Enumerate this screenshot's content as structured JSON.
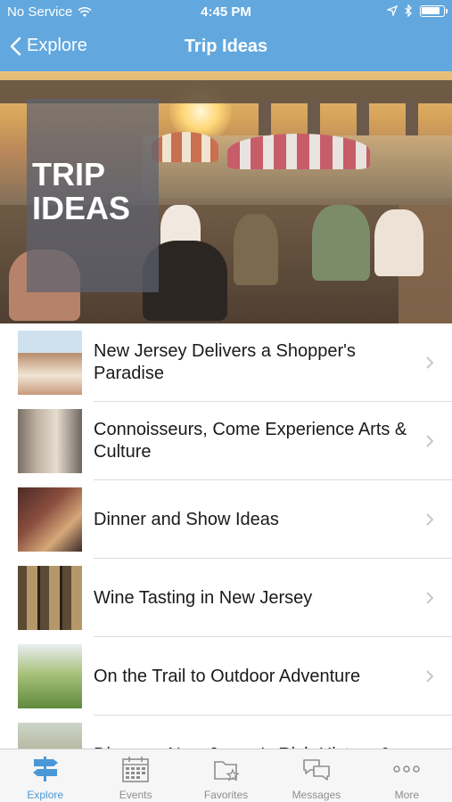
{
  "status_bar": {
    "carrier": "No Service",
    "time": "4:45 PM",
    "wifi_icon": "wifi-icon",
    "location_icon": "location-arrow-icon",
    "bluetooth_icon": "bluetooth-icon",
    "battery_icon": "battery-icon"
  },
  "nav": {
    "back_label": "Explore",
    "title": "Trip Ideas"
  },
  "hero": {
    "badge_text": "TRIP\nIDEAS"
  },
  "list": {
    "items": [
      {
        "label": "New Jersey Delivers a Shopper's Paradise"
      },
      {
        "label": "Connoisseurs, Come Experience Arts & Culture"
      },
      {
        "label": "Dinner and Show Ideas"
      },
      {
        "label": "Wine Tasting in New Jersey"
      },
      {
        "label": "On the Trail to Outdoor Adventure"
      },
      {
        "label": "Discover New Jersey's Rich History &"
      }
    ]
  },
  "tabbar": {
    "items": [
      {
        "label": "Explore",
        "icon": "signpost-icon",
        "active": true
      },
      {
        "label": "Events",
        "icon": "calendar-icon",
        "active": false
      },
      {
        "label": "Favorites",
        "icon": "folder-star-icon",
        "active": false
      },
      {
        "label": "Messages",
        "icon": "chat-bubbles-icon",
        "active": false
      },
      {
        "label": "More",
        "icon": "ellipsis-icon",
        "active": false
      }
    ]
  },
  "colors": {
    "header": "#62a8de",
    "accent": "#4a98d8",
    "tab_inactive": "#8e8e8e"
  }
}
